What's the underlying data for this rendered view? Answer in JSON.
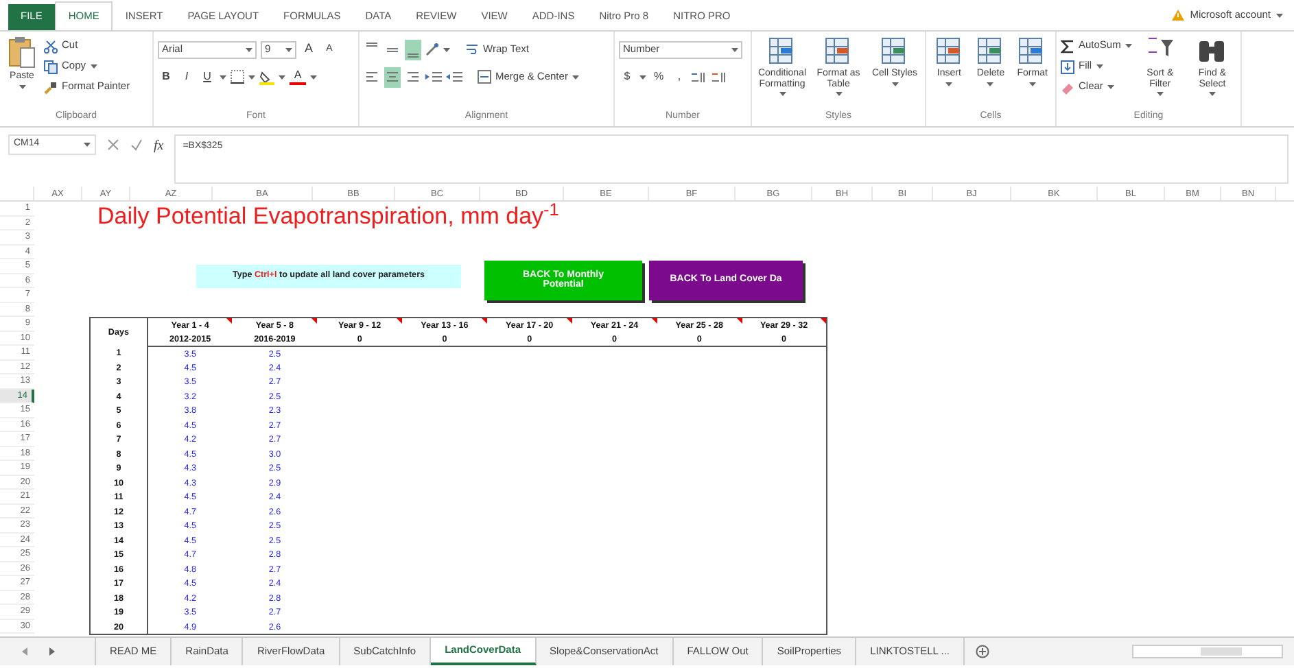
{
  "ribbon_tabs": [
    {
      "label": "FILE",
      "kind": "file",
      "selected": false
    },
    {
      "label": "HOME",
      "kind": "tab",
      "selected": true
    },
    {
      "label": "INSERT",
      "kind": "tab",
      "selected": false
    },
    {
      "label": "PAGE LAYOUT",
      "kind": "tab",
      "selected": false
    },
    {
      "label": "FORMULAS",
      "kind": "tab",
      "selected": false
    },
    {
      "label": "DATA",
      "kind": "tab",
      "selected": false
    },
    {
      "label": "REVIEW",
      "kind": "tab",
      "selected": false
    },
    {
      "label": "VIEW",
      "kind": "tab",
      "selected": false
    },
    {
      "label": "ADD-INS",
      "kind": "tab",
      "selected": false
    },
    {
      "label": "Nitro Pro 8",
      "kind": "tab",
      "selected": false
    },
    {
      "label": "NITRO PRO",
      "kind": "tab",
      "selected": false
    }
  ],
  "account": "Microsoft account",
  "ribbon_groups": [
    {
      "kind": "clipboard",
      "label": "Clipboard",
      "paste": "Paste",
      "small": [
        "Cut",
        "Copy",
        "Format Painter"
      ]
    },
    {
      "kind": "font",
      "label": "Font",
      "font": "Arial",
      "size": "9",
      "grow": [
        "A",
        "A"
      ],
      "styles": [
        "B",
        "I",
        "U"
      ],
      "color_letter": "A"
    },
    {
      "kind": "alignment",
      "label": "Alignment",
      "vertical": [
        {
          "selected": false
        },
        {
          "selected": false
        },
        {
          "selected": true
        }
      ],
      "horizontal": [
        {
          "selected": false
        },
        {
          "selected": true
        },
        {
          "selected": false
        }
      ],
      "wrap": "Wrap Text",
      "merge": "Merge & Center"
    },
    {
      "kind": "number",
      "label": "Number",
      "format": "Number",
      "symbols": [
        "$",
        "%",
        ","
      ]
    },
    {
      "kind": "styles",
      "label": "Styles",
      "large": [
        "Conditional Formatting",
        "Format as Table",
        "Cell Styles"
      ]
    },
    {
      "kind": "cells",
      "label": "Cells",
      "large": [
        "Insert",
        "Delete",
        "Format"
      ]
    },
    {
      "kind": "editing",
      "label": "Editing",
      "small": [
        "AutoSum",
        "Fill",
        "Clear"
      ],
      "large": [
        "Sort & Filter",
        "Find & Select"
      ]
    }
  ],
  "formula_bar": {
    "name_box": "CM14",
    "function_label": "fx",
    "formula": "=BX$325"
  },
  "columns": [
    "AX",
    "AY",
    "AZ",
    "BA",
    "BB",
    "BC",
    "BD",
    "BE",
    "BF",
    "BG",
    "BH",
    "BI",
    "BJ",
    "BK",
    "BL",
    "BM",
    "BN"
  ],
  "rows": [
    {
      "label": "1",
      "selected": false
    },
    {
      "label": "2",
      "selected": false
    },
    {
      "label": "3",
      "selected": false
    },
    {
      "label": "4",
      "selected": false
    },
    {
      "label": "5",
      "selected": false
    },
    {
      "label": "6",
      "selected": false
    },
    {
      "label": "7",
      "selected": false
    },
    {
      "label": "8",
      "selected": false
    },
    {
      "label": "9",
      "selected": false
    },
    {
      "label": "10",
      "selected": false
    },
    {
      "label": "11",
      "selected": false
    },
    {
      "label": "12",
      "selected": false
    },
    {
      "label": "13",
      "selected": false
    },
    {
      "label": "14",
      "selected": true
    },
    {
      "label": "15",
      "selected": false
    },
    {
      "label": "16",
      "selected": false
    },
    {
      "label": "17",
      "selected": false
    },
    {
      "label": "18",
      "selected": false
    },
    {
      "label": "19",
      "selected": false
    },
    {
      "label": "20",
      "selected": false
    },
    {
      "label": "21",
      "selected": false
    },
    {
      "label": "22",
      "selected": false
    },
    {
      "label": "23",
      "selected": false
    },
    {
      "label": "24",
      "selected": false
    },
    {
      "label": "25",
      "selected": false
    },
    {
      "label": "26",
      "selected": false
    },
    {
      "label": "27",
      "selected": false
    },
    {
      "label": "28",
      "selected": false
    },
    {
      "label": "29",
      "selected": false
    },
    {
      "label": "30",
      "selected": false
    }
  ],
  "sheet": {
    "title": "Daily Potential Evapotranspiration, mm day$^{-1}$",
    "note": "Type **Ctrl+l** to update all land cover parameters",
    "buttons": [
      {
        "label": "BACK To Monthly Potential",
        "color": "#00c000"
      },
      {
        "label": "BACK To Land Cover Da",
        "color": "#7b0a8c"
      }
    ],
    "table": {
      "first_header": "Days",
      "headers": [
        {
          "label": "Year 1 - 4",
          "period": "2012-2015"
        },
        {
          "label": "Year 5 - 8",
          "period": "2016-2019"
        },
        {
          "label": "Year 9 - 12",
          "period": "0"
        },
        {
          "label": "Year 13 - 16",
          "period": "0"
        },
        {
          "label": "Year 17 - 20",
          "period": "0"
        },
        {
          "label": "Year 21 - 24",
          "period": "0"
        },
        {
          "label": "Year 25 - 28",
          "period": "0"
        },
        {
          "label": "Year 29 - 32",
          "period": "0"
        }
      ],
      "rows": [
        {
          "day": "1",
          "values": [
            "3.5",
            "2.5"
          ]
        },
        {
          "day": "2",
          "values": [
            "4.5",
            "2.4"
          ]
        },
        {
          "day": "3",
          "values": [
            "3.5",
            "2.7"
          ]
        },
        {
          "day": "4",
          "values": [
            "3.2",
            "2.5"
          ]
        },
        {
          "day": "5",
          "values": [
            "3.8",
            "2.3"
          ]
        },
        {
          "day": "6",
          "values": [
            "4.5",
            "2.7"
          ]
        },
        {
          "day": "7",
          "values": [
            "4.2",
            "2.7"
          ]
        },
        {
          "day": "8",
          "values": [
            "4.5",
            "3.0"
          ]
        },
        {
          "day": "9",
          "values": [
            "4.3",
            "2.5"
          ]
        },
        {
          "day": "10",
          "values": [
            "4.3",
            "2.9"
          ]
        },
        {
          "day": "11",
          "values": [
            "4.5",
            "2.4"
          ]
        },
        {
          "day": "12",
          "values": [
            "4.7",
            "2.6"
          ]
        },
        {
          "day": "13",
          "values": [
            "4.5",
            "2.5"
          ]
        },
        {
          "day": "14",
          "values": [
            "4.5",
            "2.5"
          ]
        },
        {
          "day": "15",
          "values": [
            "4.7",
            "2.8"
          ]
        },
        {
          "day": "16",
          "values": [
            "4.8",
            "2.7"
          ]
        },
        {
          "day": "17",
          "values": [
            "4.5",
            "2.4"
          ]
        },
        {
          "day": "18",
          "values": [
            "4.2",
            "2.8"
          ]
        },
        {
          "day": "19",
          "values": [
            "3.5",
            "2.7"
          ]
        },
        {
          "day": "20",
          "values": [
            "4.9",
            "2.6"
          ]
        }
      ]
    }
  },
  "sheet_tabs": [
    {
      "label": "READ ME",
      "selected": false
    },
    {
      "label": "RainData",
      "selected": false
    },
    {
      "label": "RiverFlowData",
      "selected": false
    },
    {
      "label": "SubCatchInfo",
      "selected": false
    },
    {
      "label": "LandCoverData",
      "selected": true
    },
    {
      "label": "Slope&ConservationAct",
      "selected": false
    },
    {
      "label": "FALLOW Out",
      "selected": false
    },
    {
      "label": "SoilProperties",
      "selected": false
    },
    {
      "label": "LINKTOSTELL ...",
      "selected": false
    }
  ]
}
